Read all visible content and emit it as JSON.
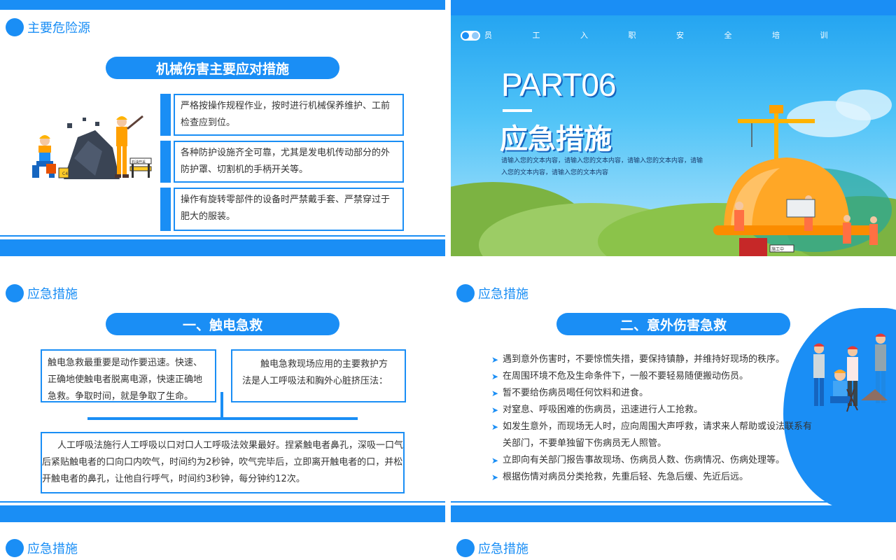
{
  "slide1": {
    "header": "主要危险源",
    "title": "机械伤害主要应对措施",
    "items": [
      "严格按操作规程作业，按时进行机械保养维护、工前检查应到位。",
      "各种防护设施齐全可靠，尤其是发电机传动部分的外防护罩、切割机的手柄开关等。",
      "操作有旋转零部件的设备时严禁戴手套、严禁穿过于肥大的服装。"
    ],
    "sign_text": "石油开采",
    "sign2_text": "C4"
  },
  "slide2": {
    "nav_text": "员 工 入 职 安 全 培 训",
    "part": "PART06",
    "title": "应急措施",
    "desc": "请输入您的文本内容，请输入您的文本内容，请输入您的文本内容，请输入您的文本内容，请输入您的文本内容",
    "sign_text": "施工中"
  },
  "slide3": {
    "header": "应急措施",
    "title": "一、触电急救",
    "box1": "触电急救最重要是动作要迅速。快速、正确地使触电者脱离电源，快速正确地急救。争取时间，就是争取了生命。",
    "box2": "触电急救现场应用的主要救护方法是人工呼吸法和胸外心脏挤压法：",
    "box3": "人工呼吸法施行人工呼吸以口对口人工呼吸法效果最好。捏紧触电者鼻孔，深吸一口气后紧贴触电者的口向口内吹气，时间约为2秒钟，吹气完毕后，立即离开触电者的口，并松开触电者的鼻孔，让他自行呼气，时间约3秒钟，每分钟约12次。"
  },
  "slide4": {
    "header": "应急措施",
    "title": "二、意外伤害急救",
    "items": [
      "遇到意外伤害时，不要惊慌失措，要保持镇静，并维持好现场的秩序。",
      "在周围环境不危及生命条件下，一般不要轻易随便搬动伤员。",
      "暂不要给伤病员喝任何饮料和进食。",
      "对窒息、呼吸困难的伤病员，迅速进行人工抢救。",
      "如发生意外，而现场无人时，应向周围大声呼救，请求来人帮助或设法联系有关部门，不要单独留下伤病员无人照管。",
      "立即向有关部门报告事故现场、伤病员人数、伤病情况、伤病处理等。",
      "根据伤情对病员分类抢救，先重后轻、先急后缓、先近后远。"
    ]
  },
  "slide5": {
    "header": "应急措施"
  },
  "slide6": {
    "header": "应急措施"
  },
  "colors": {
    "primary": "#1a8ef5",
    "sky": "#4fc3f7",
    "grass": "#8bc34a",
    "helmet": "#ffa726"
  }
}
